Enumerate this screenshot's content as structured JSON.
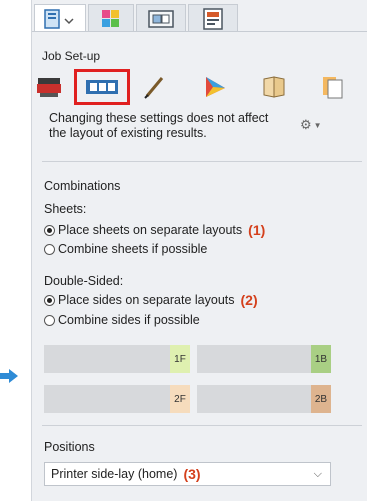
{
  "pointer": {
    "icon": "arrow-right-icon",
    "color": "#2e8bd6"
  },
  "tabs": [
    {
      "icon": "document-settings-icon"
    },
    {
      "icon": "color-palette-icon"
    },
    {
      "icon": "layout-icon"
    },
    {
      "icon": "print-queue-icon"
    }
  ],
  "section_title": "Job Set-up",
  "tools": [
    {
      "icon": "printer-icon"
    },
    {
      "icon": "sheet-layout-icon",
      "selected": true
    },
    {
      "icon": "pen-icon"
    },
    {
      "icon": "color-triangle-icon"
    },
    {
      "icon": "booklet-icon"
    },
    {
      "icon": "pages-icon"
    }
  ],
  "info_text": "Changing these settings does not affect the layout of existing results.",
  "combinations": {
    "heading": "Combinations",
    "sheets_label": "Sheets:",
    "sheets_options": [
      {
        "label": "Place sheets on separate layouts",
        "checked": true,
        "callout": "(1)"
      },
      {
        "label": "Combine sheets if possible",
        "checked": false
      }
    ],
    "double_sided_label": "Double-Sided:",
    "double_sided_options": [
      {
        "label": "Place sides on separate layouts",
        "checked": true,
        "callout": "(2)"
      },
      {
        "label": "Combine sides if possible",
        "checked": false
      }
    ]
  },
  "sides": [
    {
      "tag": "1F",
      "color": "#dff0b0"
    },
    {
      "tag": "1B",
      "color": "#a9cf84"
    },
    {
      "tag": "2F",
      "color": "#f6dcbd"
    },
    {
      "tag": "2B",
      "color": "#deb48f"
    }
  ],
  "positions": {
    "heading": "Positions",
    "selected": "Printer side-lay (home)",
    "callout": "(3)"
  },
  "colors": {
    "callout": "#d4401c",
    "selected_outline": "#e02020"
  }
}
